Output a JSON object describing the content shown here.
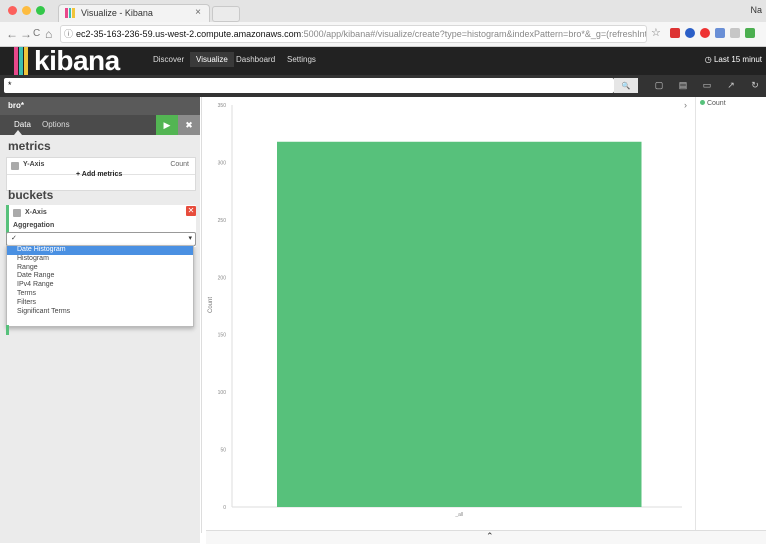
{
  "browser": {
    "tab_title": "Visualize - Kibana",
    "tab_close": "×",
    "user_label": "Na",
    "nav_back": "←",
    "nav_forward": "→",
    "nav_reload": "C",
    "nav_home": "⌂",
    "info_glyph": "ⓘ",
    "url_host": "ec2-35-163-236-59.us-west-2.compute.amazonaws.com",
    "url_rest": ":5000/app/kibana#/visualize/create?type=histogram&indexPattern=bro*&_g=(refreshInterval:(dis...",
    "star_glyph": "☆"
  },
  "kibana": {
    "logo": "kibana",
    "nav": [
      "Discover",
      "Visualize",
      "Dashboard",
      "Settings"
    ],
    "time_picker": "Last 15 minut",
    "clock_glyph": "◷",
    "query": "*",
    "search_glyph": "🔍"
  },
  "panel": {
    "index": "bro*",
    "tabs": [
      "Data",
      "Options"
    ],
    "run_glyph": "▶",
    "close_glyph": "✖",
    "collapse_glyph": "‹",
    "metrics_heading": "metrics",
    "y_axis_label": "Y-Axis",
    "y_axis_value": "Count",
    "add_metrics": "+ Add metrics",
    "buckets_heading": "buckets",
    "x_axis_label": "X-Axis",
    "aggregation_label": "Aggregation",
    "select_checkmark": "✓",
    "select_caret": "▾",
    "delete_glyph": "✕",
    "aggregation_options": [
      "Date Histogram",
      "Histogram",
      "Range",
      "Date Range",
      "IPv4 Range",
      "Terms",
      "Filters",
      "Significant Terms"
    ],
    "selected_option": "Date Histogram"
  },
  "legend": {
    "items": [
      {
        "name": "Count",
        "color": "#57c17b"
      }
    ],
    "toggle_glyph": "›"
  },
  "bottom": {
    "collapse_glyph": "⌃"
  },
  "colors": {
    "accent_green": "#57c17b",
    "danger_red": "#e74c3c",
    "select_blue": "#4a90e2"
  },
  "chart_data": {
    "type": "bar",
    "categories": [
      "_all"
    ],
    "series": [
      {
        "name": "Count",
        "values": [
          318
        ]
      }
    ],
    "ylabel": "Count",
    "xlabel": "",
    "ylim": [
      0,
      350
    ],
    "yticks": [
      0,
      50,
      100,
      150,
      200,
      250,
      300,
      350
    ],
    "grid": false,
    "legend": "right"
  }
}
